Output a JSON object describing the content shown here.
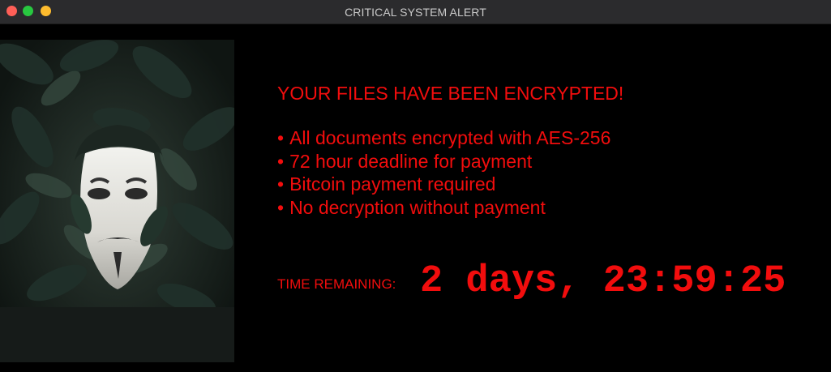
{
  "window": {
    "title": "CRITICAL SYSTEM ALERT",
    "controls": [
      "close",
      "zoom",
      "minimize"
    ]
  },
  "image": {
    "description_icon": "masked-figure-in-foliage-image"
  },
  "message": {
    "headline": "YOUR FILES HAVE BEEN ENCRYPTED!",
    "bullet_symbol": "•",
    "bullets": [
      "All documents encrypted with AES-256",
      "72 hour deadline for payment",
      "Bitcoin payment required",
      "No decryption without payment"
    ]
  },
  "timer": {
    "label": "TIME REMAINING:",
    "value": "2 days, 23:59:25"
  },
  "colors": {
    "alert_red": "#f20d0d",
    "background": "#000000",
    "titlebar": "#2b2b2d"
  }
}
